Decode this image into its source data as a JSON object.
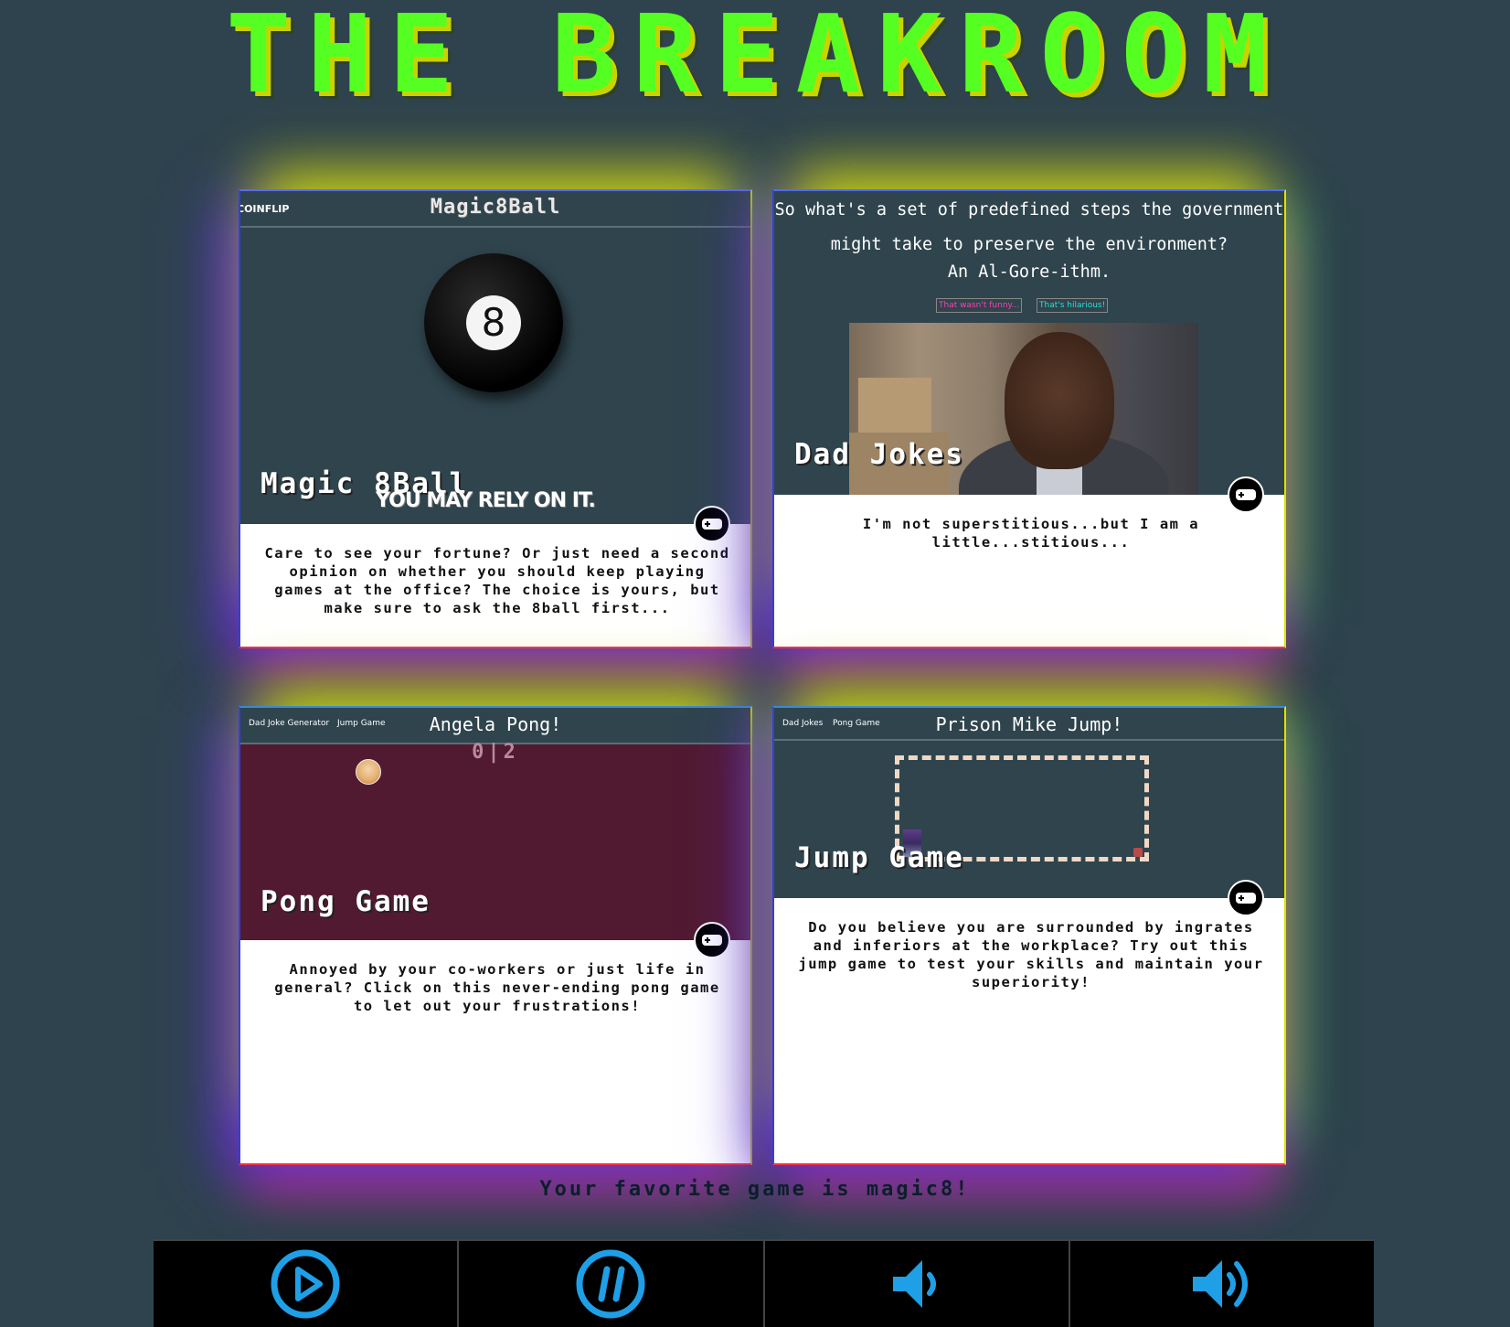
{
  "site": {
    "title": "THE BREAKROOM"
  },
  "colors": {
    "accent_green": "#55ff22",
    "icon_blue": "#1e9fe6",
    "background": "#2e434d",
    "pong_bg": "#521a31"
  },
  "cards": {
    "magic8": {
      "nav_link": "COINFLIP",
      "nav_title": "Magic8Ball",
      "ball_number": "8",
      "tagline": "YOU MAY RELY ON IT.",
      "label": "Magic 8Ball",
      "description": "Care to see your fortune? Or just need a second opinion on whether you should keep playing games at the office? The choice is yours, but make sure to ask the 8ball first...",
      "badge_icon": "gamepad-icon"
    },
    "dadjokes": {
      "joke_setup": "So what's a set of predefined steps the government might take to preserve the environment?",
      "joke_punchline": "An Al-Gore-ithm.",
      "button_not_funny": "That wasn't funny...",
      "button_hilarious": "That's hilarious!",
      "label": "Dad Jokes",
      "description": "I'm not superstitious...but I am a little...stitious...",
      "badge_icon": "gamepad-icon"
    },
    "pong": {
      "nav_link_1": "Dad Joke Generator",
      "nav_link_2": "Jump Game",
      "nav_title": "Angela Pong!",
      "score": "0|2",
      "label": "Pong Game",
      "description": "Annoyed by your co-workers or just life in general? Click on this never-ending pong game to let out your frustrations!",
      "badge_icon": "gamepad-icon"
    },
    "jump": {
      "nav_link_1": "Dad Jokes",
      "nav_link_2": "Pong Game",
      "nav_title": "Prison Mike Jump!",
      "label": "Jump Game",
      "description": "Do you believe you are surrounded by ingrates and inferiors at the workplace? Try out this jump game to test your skills and maintain your superiority!",
      "badge_icon": "gamepad-icon"
    }
  },
  "favorite_text": "Your favorite game is magic8!",
  "player": {
    "buttons": [
      {
        "icon": "play-icon"
      },
      {
        "icon": "pause-icon"
      },
      {
        "icon": "volume-down-icon"
      },
      {
        "icon": "volume-up-icon"
      }
    ]
  }
}
